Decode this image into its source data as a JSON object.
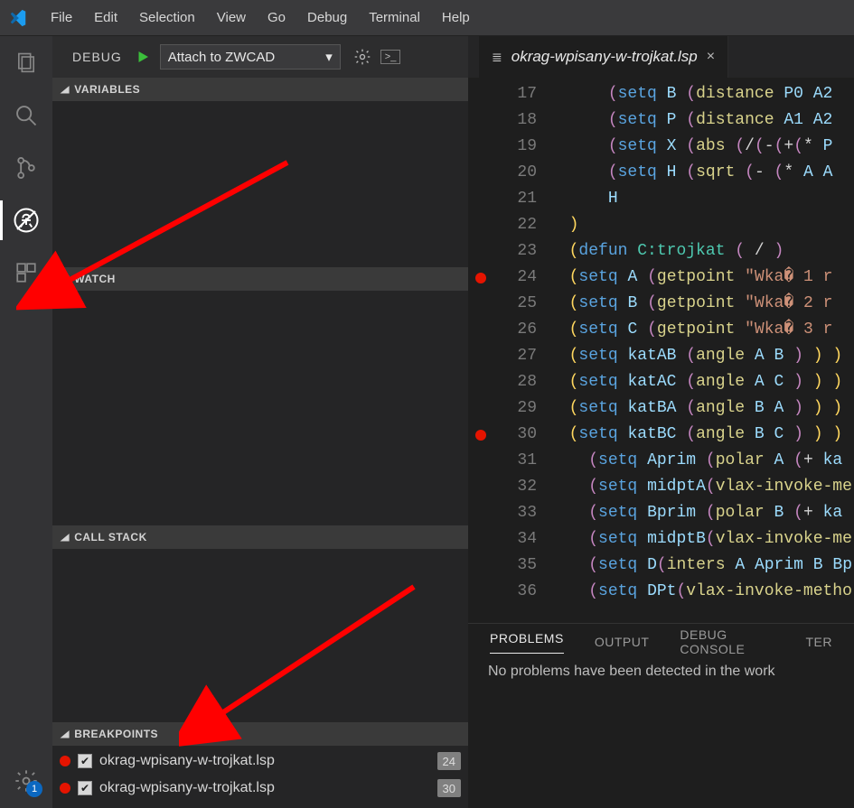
{
  "menu": [
    "File",
    "Edit",
    "Selection",
    "View",
    "Go",
    "Debug",
    "Terminal",
    "Help"
  ],
  "debug": {
    "header_label": "DEBUG",
    "config_name": "Attach to ZWCAD",
    "sections": {
      "variables": "VARIABLES",
      "watch": "WATCH",
      "callstack": "CALL STACK",
      "breakpoints": "BREAKPOINTS"
    },
    "breakpoints": [
      {
        "file": "okrag-wpisany-w-trojkat.lsp",
        "line": 24,
        "checked": true
      },
      {
        "file": "okrag-wpisany-w-trojkat.lsp",
        "line": 30,
        "checked": true
      }
    ]
  },
  "settings_badge": "1",
  "editor": {
    "tab_filename": "okrag-wpisany-w-trojkat.lsp",
    "first_line": 17,
    "breakpoint_lines": [
      24,
      30
    ],
    "lines": [
      {
        "indent": 3,
        "tokens": [
          [
            "par",
            "("
          ],
          [
            "kw",
            "setq"
          ],
          [
            "op",
            " "
          ],
          [
            "var",
            "B"
          ],
          [
            "op",
            " "
          ],
          [
            "par",
            "("
          ],
          [
            "fn",
            "distance"
          ],
          [
            "op",
            " "
          ],
          [
            "var",
            "P0"
          ],
          [
            "op",
            " "
          ],
          [
            "var",
            "A2"
          ]
        ]
      },
      {
        "indent": 3,
        "tokens": [
          [
            "par",
            "("
          ],
          [
            "kw",
            "setq"
          ],
          [
            "op",
            " "
          ],
          [
            "var",
            "P"
          ],
          [
            "op",
            " "
          ],
          [
            "par",
            "("
          ],
          [
            "fn",
            "distance"
          ],
          [
            "op",
            " "
          ],
          [
            "var",
            "A1"
          ],
          [
            "op",
            " "
          ],
          [
            "var",
            "A2"
          ]
        ]
      },
      {
        "indent": 3,
        "tokens": [
          [
            "par",
            "("
          ],
          [
            "kw",
            "setq"
          ],
          [
            "op",
            " "
          ],
          [
            "var",
            "X"
          ],
          [
            "op",
            " "
          ],
          [
            "par",
            "("
          ],
          [
            "fn",
            "abs"
          ],
          [
            "op",
            " "
          ],
          [
            "par",
            "("
          ],
          [
            "op",
            "/"
          ],
          [
            "par",
            "("
          ],
          [
            "op",
            "-"
          ],
          [
            "par",
            "("
          ],
          [
            "op",
            "+"
          ],
          [
            "par",
            "("
          ],
          [
            "op",
            "* "
          ],
          [
            "var",
            "P"
          ]
        ]
      },
      {
        "indent": 3,
        "tokens": [
          [
            "par",
            "("
          ],
          [
            "kw",
            "setq"
          ],
          [
            "op",
            " "
          ],
          [
            "var",
            "H"
          ],
          [
            "op",
            " "
          ],
          [
            "par",
            "("
          ],
          [
            "fn",
            "sqrt"
          ],
          [
            "op",
            " "
          ],
          [
            "par",
            "("
          ],
          [
            "op",
            "- "
          ],
          [
            "par",
            "("
          ],
          [
            "op",
            "* "
          ],
          [
            "var",
            "A"
          ],
          [
            "op",
            " "
          ],
          [
            "var",
            "A"
          ]
        ]
      },
      {
        "indent": 3,
        "tokens": [
          [
            "var",
            "H"
          ]
        ]
      },
      {
        "indent": 1,
        "tokens": [
          [
            "par-out",
            ")"
          ]
        ]
      },
      {
        "indent": 1,
        "tokens": [
          [
            "par-out",
            "("
          ],
          [
            "kw",
            "defun"
          ],
          [
            "op",
            " "
          ],
          [
            "type",
            "C:trojkat"
          ],
          [
            "op",
            " "
          ],
          [
            "par",
            "( "
          ],
          [
            "op",
            "/"
          ],
          [
            "par",
            " )"
          ]
        ]
      },
      {
        "indent": 1,
        "tokens": [
          [
            "par-out",
            "("
          ],
          [
            "kw",
            "setq"
          ],
          [
            "op",
            " "
          ],
          [
            "var",
            "A"
          ],
          [
            "op",
            " "
          ],
          [
            "par",
            "("
          ],
          [
            "fn",
            "getpoint"
          ],
          [
            "op",
            " "
          ],
          [
            "str",
            "\"Wka� 1 r"
          ]
        ]
      },
      {
        "indent": 1,
        "tokens": [
          [
            "par-out",
            "("
          ],
          [
            "kw",
            "setq"
          ],
          [
            "op",
            " "
          ],
          [
            "var",
            "B"
          ],
          [
            "op",
            " "
          ],
          [
            "par",
            "("
          ],
          [
            "fn",
            "getpoint"
          ],
          [
            "op",
            " "
          ],
          [
            "str",
            "\"Wka� 2 r"
          ]
        ]
      },
      {
        "indent": 1,
        "tokens": [
          [
            "par-out",
            "("
          ],
          [
            "kw",
            "setq"
          ],
          [
            "op",
            " "
          ],
          [
            "var",
            "C"
          ],
          [
            "op",
            " "
          ],
          [
            "par",
            "("
          ],
          [
            "fn",
            "getpoint"
          ],
          [
            "op",
            " "
          ],
          [
            "str",
            "\"Wka� 3 r"
          ]
        ]
      },
      {
        "indent": 1,
        "tokens": [
          [
            "par-out",
            "("
          ],
          [
            "kw",
            "setq"
          ],
          [
            "op",
            " "
          ],
          [
            "var",
            "katAB"
          ],
          [
            "op",
            " "
          ],
          [
            "par",
            "("
          ],
          [
            "fn",
            "angle"
          ],
          [
            "op",
            " "
          ],
          [
            "var",
            "A"
          ],
          [
            "op",
            " "
          ],
          [
            "var",
            "B"
          ],
          [
            "op",
            " "
          ],
          [
            "par",
            ")"
          ],
          [
            "op",
            " "
          ],
          [
            "par-out",
            ")"
          ],
          [
            "op",
            " "
          ],
          [
            "par-out",
            ")"
          ]
        ]
      },
      {
        "indent": 1,
        "tokens": [
          [
            "par-out",
            "("
          ],
          [
            "kw",
            "setq"
          ],
          [
            "op",
            " "
          ],
          [
            "var",
            "katAC"
          ],
          [
            "op",
            " "
          ],
          [
            "par",
            "("
          ],
          [
            "fn",
            "angle"
          ],
          [
            "op",
            " "
          ],
          [
            "var",
            "A"
          ],
          [
            "op",
            " "
          ],
          [
            "var",
            "C"
          ],
          [
            "op",
            " "
          ],
          [
            "par",
            ")"
          ],
          [
            "op",
            " "
          ],
          [
            "par-out",
            ")"
          ],
          [
            "op",
            " "
          ],
          [
            "par-out",
            ")"
          ]
        ]
      },
      {
        "indent": 1,
        "tokens": [
          [
            "par-out",
            "("
          ],
          [
            "kw",
            "setq"
          ],
          [
            "op",
            " "
          ],
          [
            "var",
            "katBA"
          ],
          [
            "op",
            " "
          ],
          [
            "par",
            "("
          ],
          [
            "fn",
            "angle"
          ],
          [
            "op",
            " "
          ],
          [
            "var",
            "B"
          ],
          [
            "op",
            " "
          ],
          [
            "var",
            "A"
          ],
          [
            "op",
            " "
          ],
          [
            "par",
            ")"
          ],
          [
            "op",
            " "
          ],
          [
            "par-out",
            ")"
          ],
          [
            "op",
            " "
          ],
          [
            "par-out",
            ")"
          ]
        ]
      },
      {
        "indent": 1,
        "tokens": [
          [
            "par-out",
            "("
          ],
          [
            "kw",
            "setq"
          ],
          [
            "op",
            " "
          ],
          [
            "var",
            "katBC"
          ],
          [
            "op",
            " "
          ],
          [
            "par",
            "("
          ],
          [
            "fn",
            "angle"
          ],
          [
            "op",
            " "
          ],
          [
            "var",
            "B"
          ],
          [
            "op",
            " "
          ],
          [
            "var",
            "C"
          ],
          [
            "op",
            " "
          ],
          [
            "par",
            ")"
          ],
          [
            "op",
            " "
          ],
          [
            "par-out",
            ")"
          ],
          [
            "op",
            " "
          ],
          [
            "par-out",
            ")"
          ]
        ]
      },
      {
        "indent": 2,
        "tokens": [
          [
            "par",
            "("
          ],
          [
            "kw",
            "setq"
          ],
          [
            "op",
            " "
          ],
          [
            "var",
            "Aprim"
          ],
          [
            "op",
            " "
          ],
          [
            "par",
            "("
          ],
          [
            "fn",
            "polar"
          ],
          [
            "op",
            " "
          ],
          [
            "var",
            "A"
          ],
          [
            "op",
            " "
          ],
          [
            "par",
            "("
          ],
          [
            "op",
            "+ "
          ],
          [
            "var",
            "ka"
          ]
        ]
      },
      {
        "indent": 2,
        "tokens": [
          [
            "par",
            "("
          ],
          [
            "kw",
            "setq"
          ],
          [
            "op",
            " "
          ],
          [
            "var",
            "midptA"
          ],
          [
            "par",
            "("
          ],
          [
            "fn",
            "vlax-invoke-me"
          ]
        ]
      },
      {
        "indent": 2,
        "tokens": [
          [
            "par",
            "("
          ],
          [
            "kw",
            "setq"
          ],
          [
            "op",
            " "
          ],
          [
            "var",
            "Bprim"
          ],
          [
            "op",
            " "
          ],
          [
            "par",
            "("
          ],
          [
            "fn",
            "polar"
          ],
          [
            "op",
            " "
          ],
          [
            "var",
            "B"
          ],
          [
            "op",
            " "
          ],
          [
            "par",
            "("
          ],
          [
            "op",
            "+ "
          ],
          [
            "var",
            "ka"
          ]
        ]
      },
      {
        "indent": 2,
        "tokens": [
          [
            "par",
            "("
          ],
          [
            "kw",
            "setq"
          ],
          [
            "op",
            " "
          ],
          [
            "var",
            "midptB"
          ],
          [
            "par",
            "("
          ],
          [
            "fn",
            "vlax-invoke-me"
          ]
        ]
      },
      {
        "indent": 2,
        "tokens": [
          [
            "par",
            "("
          ],
          [
            "kw",
            "setq"
          ],
          [
            "op",
            " "
          ],
          [
            "var",
            "D"
          ],
          [
            "par",
            "("
          ],
          [
            "fn",
            "inters"
          ],
          [
            "op",
            " "
          ],
          [
            "var",
            "A"
          ],
          [
            "op",
            " "
          ],
          [
            "var",
            "Aprim"
          ],
          [
            "op",
            " "
          ],
          [
            "var",
            "B"
          ],
          [
            "op",
            " "
          ],
          [
            "var",
            "Bp"
          ]
        ]
      },
      {
        "indent": 2,
        "tokens": [
          [
            "par",
            "("
          ],
          [
            "kw",
            "setq"
          ],
          [
            "op",
            " "
          ],
          [
            "var",
            "DPt"
          ],
          [
            "par",
            "("
          ],
          [
            "fn",
            "vlax-invoke-metho"
          ]
        ]
      }
    ]
  },
  "panel": {
    "tabs": [
      "PROBLEMS",
      "OUTPUT",
      "DEBUG CONSOLE",
      "TER"
    ],
    "active": 0,
    "message": "No problems have been detected in the work"
  }
}
